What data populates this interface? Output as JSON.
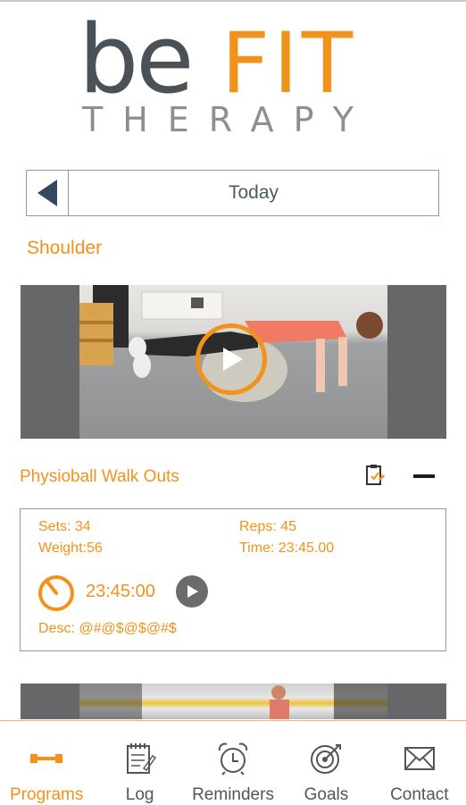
{
  "brand": {
    "be": "be",
    "fit": "FIT",
    "therapy": "THERAPY"
  },
  "date_nav": {
    "label": "Today"
  },
  "section": {
    "title": "Shoulder"
  },
  "exercise": {
    "name": "Physioball Walk Outs",
    "sets": "Sets: 34",
    "reps": "Reps: 45",
    "weight": "Weight:56",
    "time": "Time: 23:45.00",
    "timer": "23:45:00",
    "desc": "Desc: @#@$@$@#$"
  },
  "tabs": [
    {
      "label": "Programs",
      "icon": "dumbbell-icon",
      "active": true
    },
    {
      "label": "Log",
      "icon": "notepad-icon"
    },
    {
      "label": "Reminders",
      "icon": "alarm-clock-icon"
    },
    {
      "label": "Goals",
      "icon": "target-icon"
    },
    {
      "label": "Contact",
      "icon": "envelope-icon"
    }
  ],
  "colors": {
    "accent": "#f2921b",
    "logo_dark": "#4a5258",
    "border": "#8b9aa6"
  }
}
